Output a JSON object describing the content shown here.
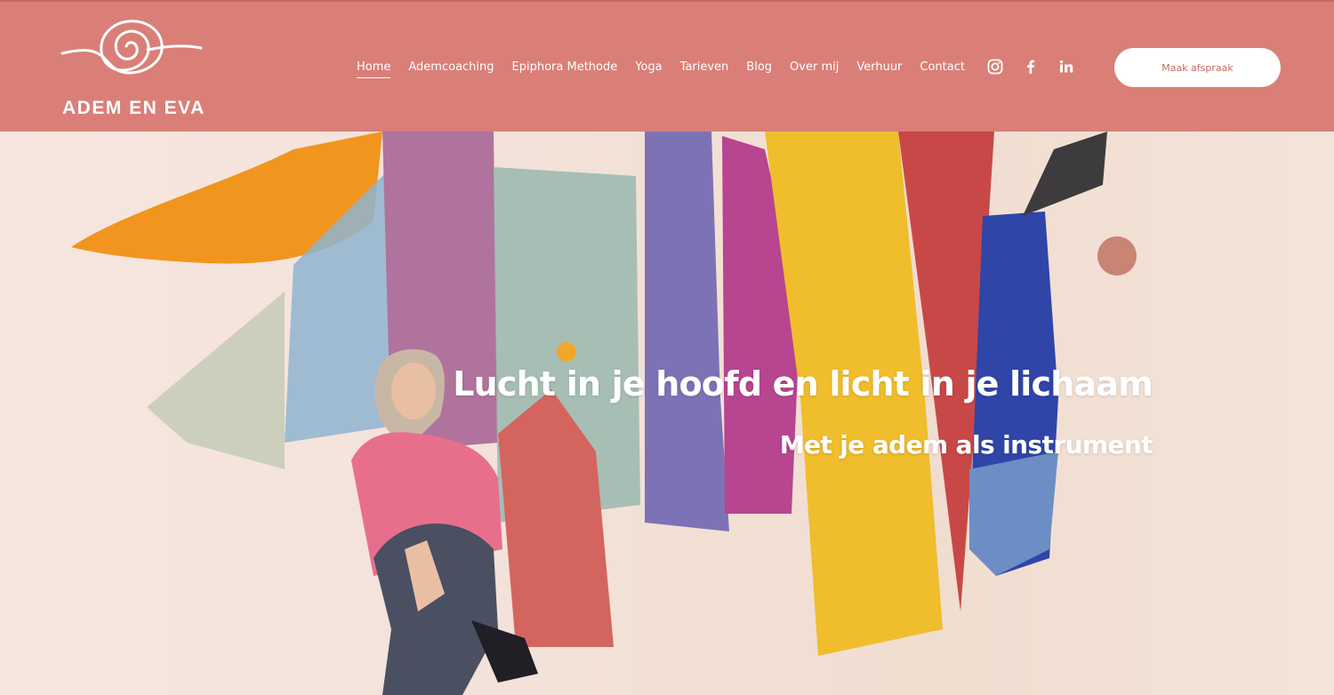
{
  "brand": {
    "name": "ADEM EN EVA"
  },
  "nav": {
    "items": [
      {
        "label": "Home",
        "active": true
      },
      {
        "label": "Ademcoaching",
        "active": false
      },
      {
        "label": "Epiphora Methode",
        "active": false
      },
      {
        "label": "Yoga",
        "active": false
      },
      {
        "label": "Tarieven",
        "active": false
      },
      {
        "label": "Blog",
        "active": false
      },
      {
        "label": "Over mij",
        "active": false
      },
      {
        "label": "Verhuur",
        "active": false
      },
      {
        "label": "Contact",
        "active": false
      }
    ]
  },
  "social": [
    "instagram-icon",
    "facebook-icon",
    "linkedin-icon"
  ],
  "cta": {
    "label": "Maak afspraak"
  },
  "hero": {
    "headline": "Lucht in je hoofd en licht in je lichaam",
    "subheadline": "Met je adem als instrument"
  },
  "colors": {
    "header": "#d97f78",
    "button_text": "#c56a63"
  }
}
